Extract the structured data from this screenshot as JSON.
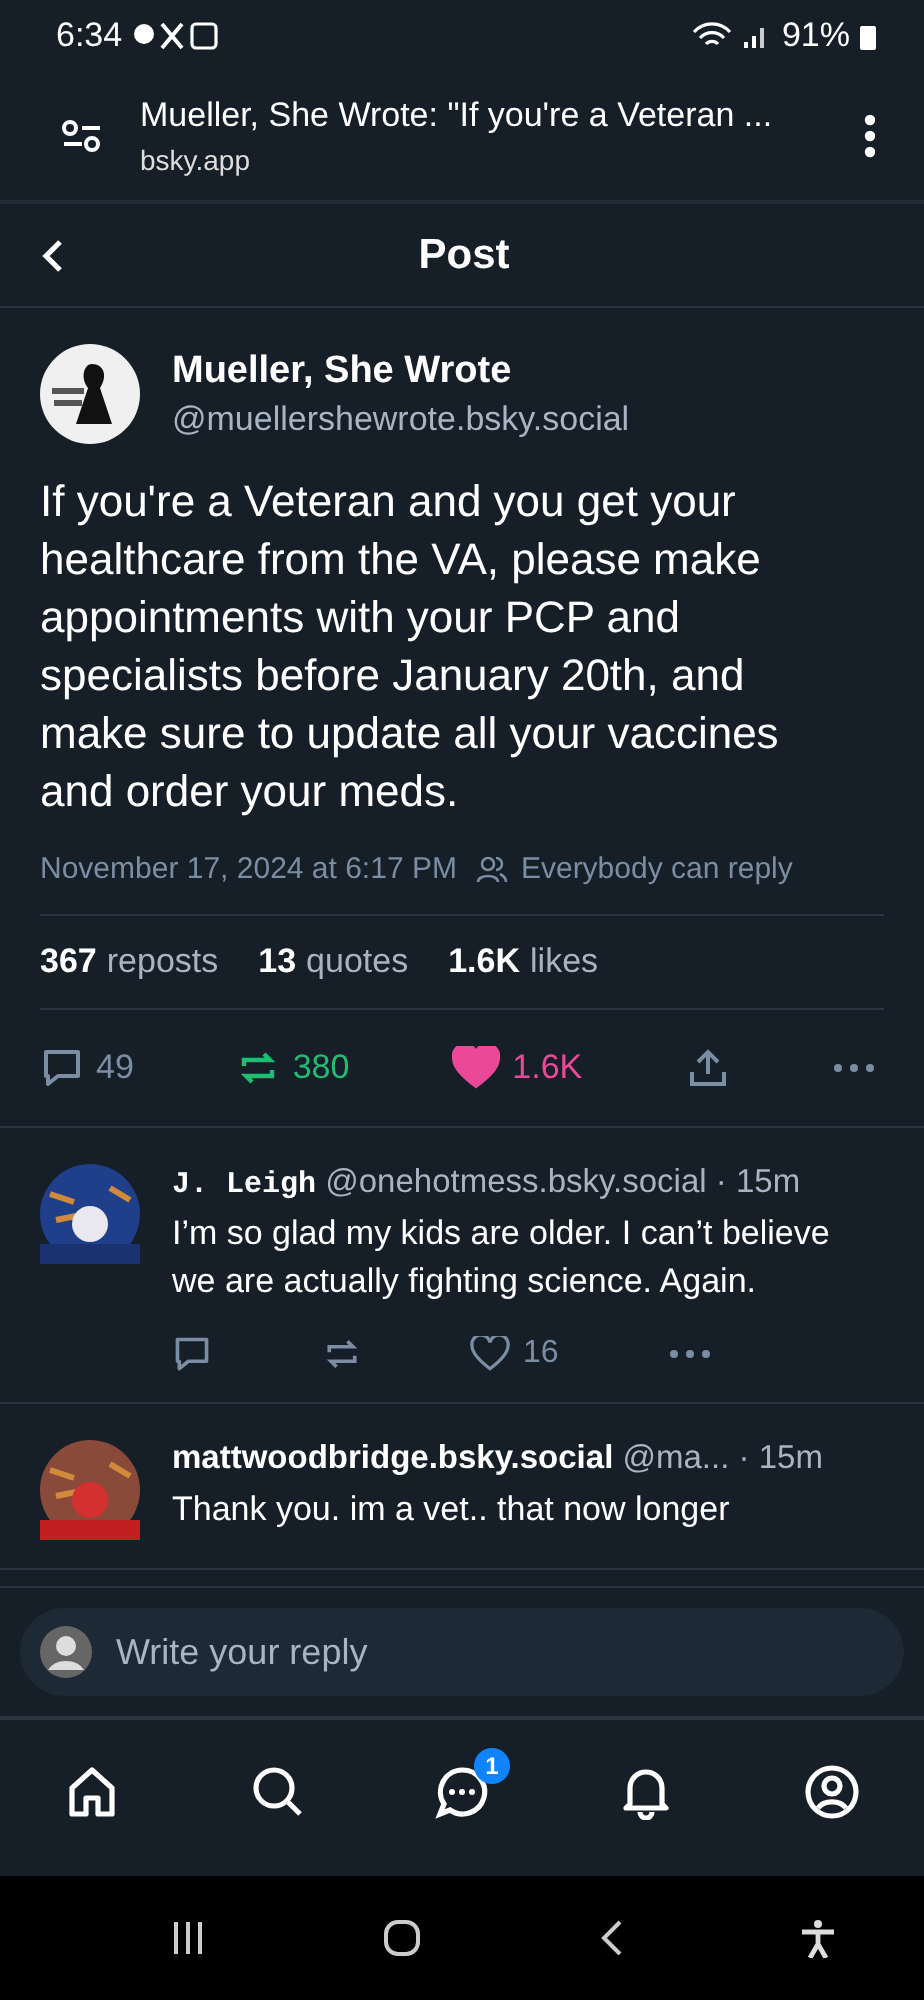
{
  "status_bar": {
    "time": "6:34",
    "battery": "91%"
  },
  "browser": {
    "title": "Mueller, She Wrote: \"If you're a Veteran ...",
    "url": "bsky.app"
  },
  "header": {
    "title": "Post"
  },
  "post": {
    "name": "Mueller, She Wrote",
    "handle": "@muellershewrote.bsky.social",
    "text": "If you're a Veteran and you get your healthcare from the VA, please make appointments with your PCP and specialists before January 20th, and make sure to update all your vaccines and order your meds.",
    "date": "November 17, 2024 at 6:17 PM",
    "audience": "Everybody can reply",
    "stats": [
      {
        "count": "367",
        "label": "reposts"
      },
      {
        "count": "13",
        "label": "quotes"
      },
      {
        "count": "1.6K",
        "label": "likes"
      }
    ],
    "replies": "49",
    "reposts": "380",
    "likes": "1.6K",
    "reposted": true,
    "liked": true
  },
  "replies": [
    {
      "name": "J. Leigh",
      "mono": true,
      "handle": "@onehotmess.bsky.social",
      "time": "· 15m",
      "text": "I’m so glad my kids are older. I can’t believe we are actually fighting science. Again.",
      "likes": "16",
      "liked": false,
      "reposted": false
    },
    {
      "name": "mattwoodbridge.bsky.social",
      "mono": false,
      "handle": "@ma...",
      "time": "· 15m",
      "text": "Thank you. im a vet.. that now longer"
    }
  ],
  "composer": {
    "placeholder": "Write your reply"
  },
  "nav": [
    {
      "kind": "home"
    },
    {
      "kind": "search"
    },
    {
      "kind": "chat",
      "badge": "1"
    },
    {
      "kind": "bell"
    },
    {
      "kind": "profile"
    }
  ]
}
